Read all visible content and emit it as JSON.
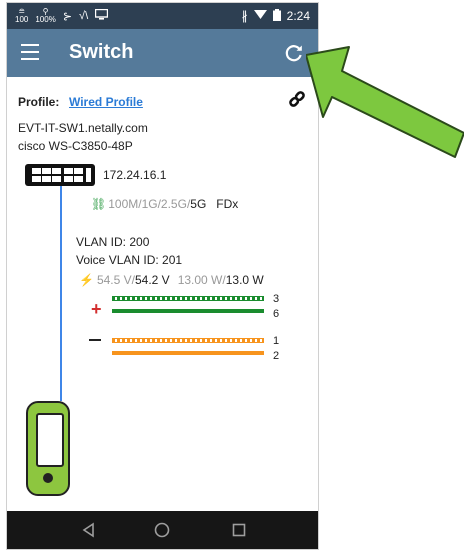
{
  "status_bar": {
    "left_items": [
      "100",
      "100%"
    ],
    "time": "2:24"
  },
  "app_bar": {
    "title": "Switch",
    "menu_icon": "hamburger-menu-icon",
    "refresh_icon": "refresh-icon"
  },
  "profile": {
    "label": "Profile:",
    "value": "Wired Profile"
  },
  "switch": {
    "hostname": "EVT-IT-SW1.netally.com",
    "model": "cisco WS-C3850-48P",
    "ip": "172.24.16.1"
  },
  "link": {
    "speeds_inactive": "100M/1G/2.5G/",
    "speed_active": "5G",
    "duplex": "FDx"
  },
  "vlan": {
    "vlan_id": "VLAN ID: 200",
    "voice_vlan_id": "Voice VLAN ID: 201"
  },
  "poe": {
    "voltage_inactive": "54.5 V/",
    "voltage_active": "54.2 V",
    "power_inactive": "13.00 W/",
    "power_active": "13.0 W"
  },
  "pairs": {
    "plus_sign": "+",
    "plus_a": "3",
    "plus_b": "6",
    "minus_a": "1",
    "minus_b": "2",
    "green": "#1a8c2e",
    "orange": "#f7941d"
  },
  "colors": {
    "status_bar": "#2d3f52",
    "app_bar": "#557a9a",
    "link_blue": "#2b7bd6",
    "cable_blue": "#3f86e8",
    "device_green": "#8dc63f",
    "arrow_green": "#7dc83f"
  }
}
